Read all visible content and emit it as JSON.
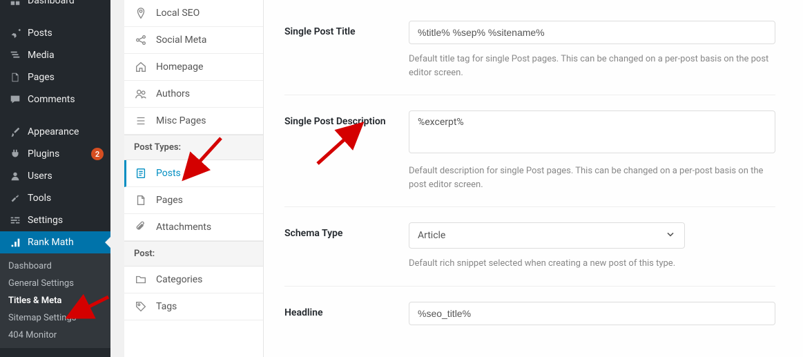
{
  "wp_menu": {
    "dashboard": "Dashboard",
    "posts": "Posts",
    "media": "Media",
    "pages": "Pages",
    "comments": "Comments",
    "appearance": "Appearance",
    "plugins": "Plugins",
    "plugins_badge": "2",
    "users": "Users",
    "tools": "Tools",
    "settings": "Settings",
    "rank_math": "Rank Math"
  },
  "rm_submenu": {
    "dashboard": "Dashboard",
    "general": "General Settings",
    "titles": "Titles & Meta",
    "sitemap": "Sitemap Settings",
    "monitor": "404 Monitor"
  },
  "rm_tabs": {
    "local_seo": "Local SEO",
    "social": "Social Meta",
    "homepage": "Homepage",
    "authors": "Authors",
    "misc": "Misc Pages",
    "post_types_header": "Post Types:",
    "posts": "Posts",
    "pages": "Pages",
    "attachments": "Attachments",
    "post_header": "Post:",
    "categories": "Categories",
    "tags": "Tags"
  },
  "fields": {
    "single_title": {
      "label": "Single Post Title",
      "value": "%title% %sep% %sitename%",
      "desc": "Default title tag for single Post pages. This can be changed on a per-post basis on the post editor screen."
    },
    "single_desc": {
      "label": "Single Post Description",
      "value": "%excerpt%",
      "desc": "Default description for single Post pages. This can be changed on a per-post basis on the post editor screen."
    },
    "schema": {
      "label": "Schema Type",
      "value": "Article",
      "desc": "Default rich snippet selected when creating a new post of this type."
    },
    "headline": {
      "label": "Headline",
      "value": "%seo_title%"
    }
  }
}
